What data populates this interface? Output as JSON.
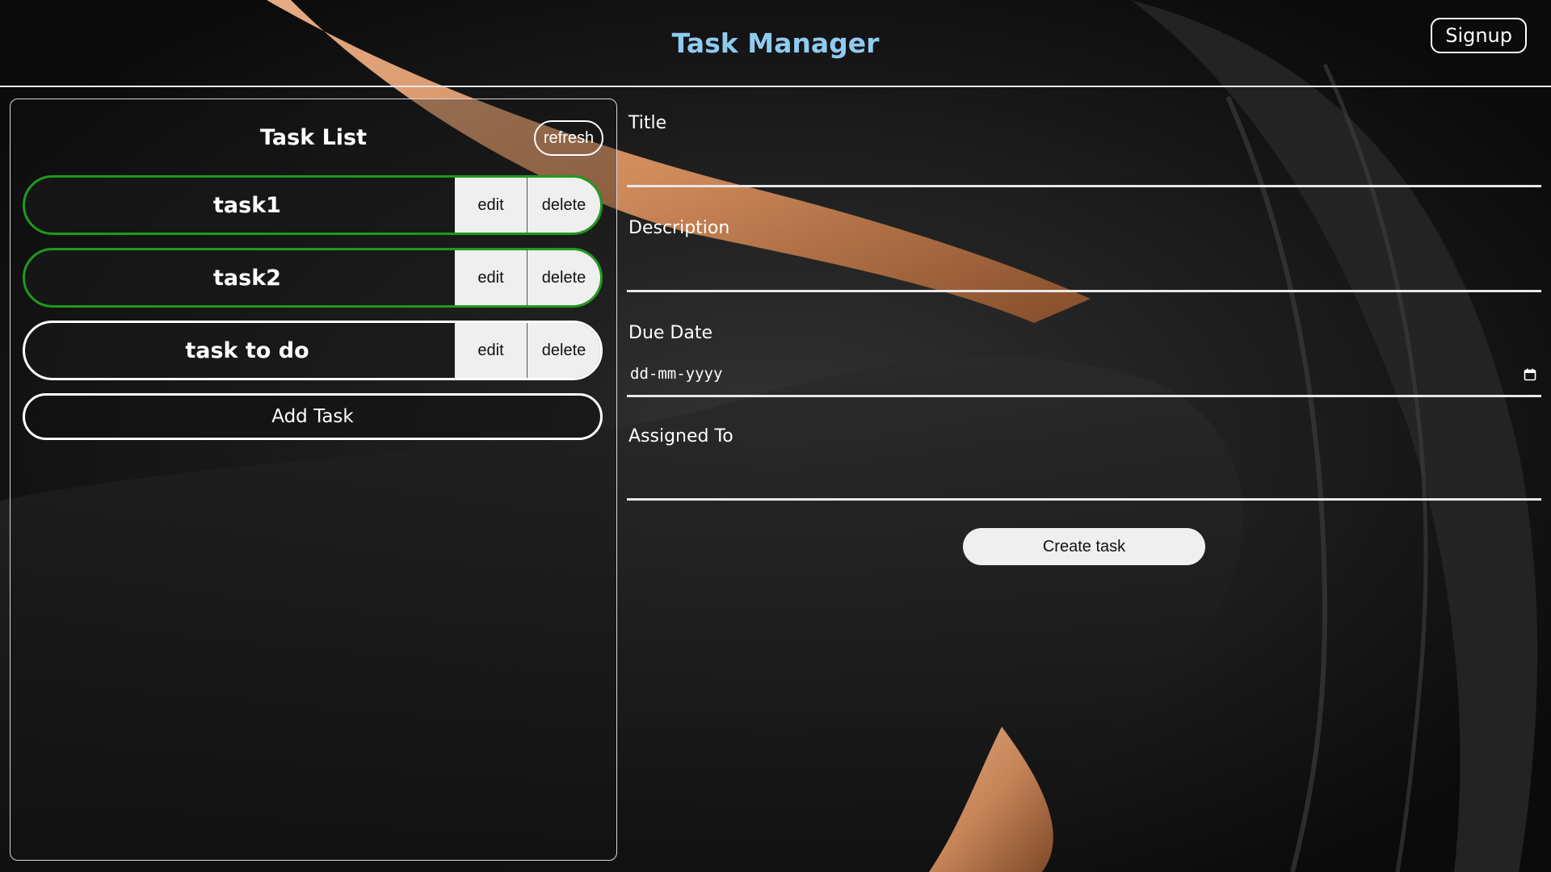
{
  "header": {
    "title": "Task Manager",
    "signup_label": "Signup"
  },
  "task_list": {
    "title": "Task List",
    "refresh_label": "refresh",
    "tasks": [
      {
        "name": "task1",
        "completed": true
      },
      {
        "name": "task2",
        "completed": true
      },
      {
        "name": "task to do",
        "completed": false
      }
    ],
    "edit_label": "edit",
    "delete_label": "delete",
    "add_task_label": "Add Task"
  },
  "form": {
    "title_label": "Title",
    "description_label": "Description",
    "due_date_label": "Due Date",
    "due_date_placeholder": "dd-mm-yyyy",
    "assigned_to_label": "Assigned To",
    "create_label": "Create task"
  },
  "colors": {
    "title_accent": "#8fcbf0",
    "completed_border": "#1e9a1e",
    "pending_border": "#ffffff",
    "button_fill": "#efefef",
    "background_swirl": "#d9915f"
  },
  "icons": {
    "calendar": "calendar-icon"
  }
}
